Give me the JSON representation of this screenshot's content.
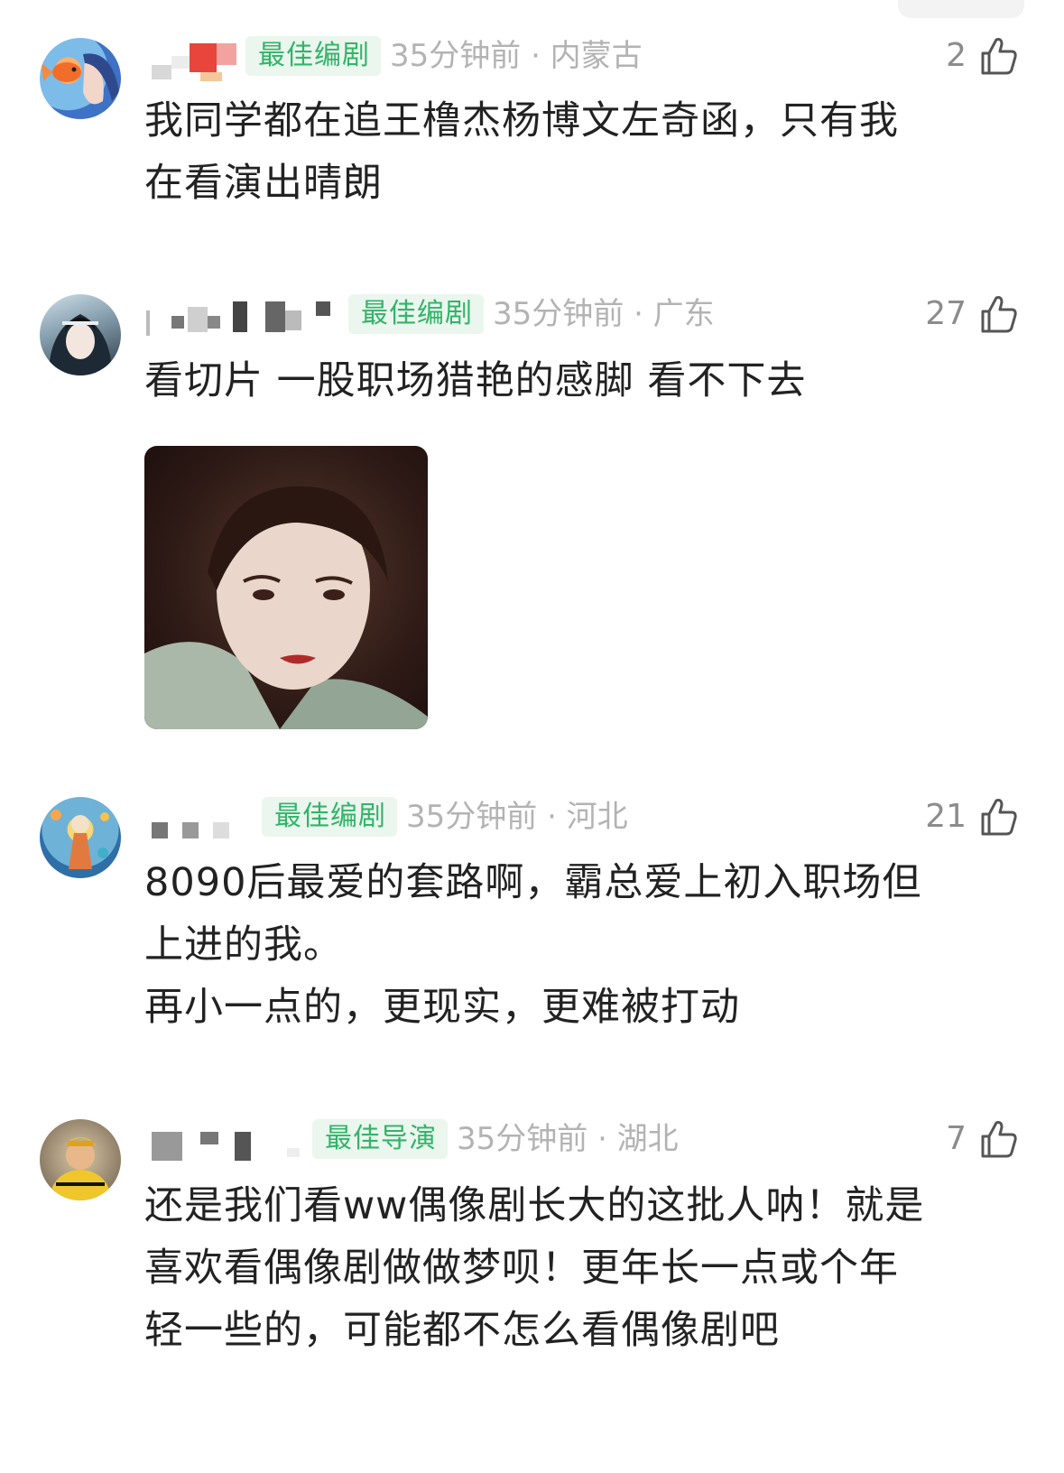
{
  "comments": [
    {
      "badge": "最佳编剧",
      "meta": "35分钟前 · 内蒙古",
      "likes": "2",
      "lines": [
        "我同学都在追王橹杰杨博文左奇函，只有我",
        "在看演出晴朗"
      ]
    },
    {
      "badge": "最佳编剧",
      "meta": "35分钟前 · 广东",
      "likes": "27",
      "lines": [
        "看切片 一股职场猎艳的感脚 看不下去"
      ]
    },
    {
      "badge": "最佳编剧",
      "meta": "35分钟前 · 河北",
      "likes": "21",
      "lines": [
        "8090后最爱的套路啊，霸总爱上初入职场但",
        "上进的我。",
        "再小一点的，更现实，更难被打动"
      ]
    },
    {
      "badge": "最佳导演",
      "meta": "35分钟前 · 湖北",
      "likes": "7",
      "lines": [
        "还是我们看ww偶像剧长大的这批人呐！就是",
        "喜欢看偶像剧做做梦呗！更年长一点或个年",
        "轻一些的，可能都不怎么看偶像剧吧"
      ]
    }
  ],
  "icons": {
    "like": "thumbs-up-icon"
  },
  "colors": {
    "badge_text": "#32b468",
    "badge_bg": "#eaf6ee",
    "meta": "#b3b3b3",
    "body_text": "#222222"
  }
}
